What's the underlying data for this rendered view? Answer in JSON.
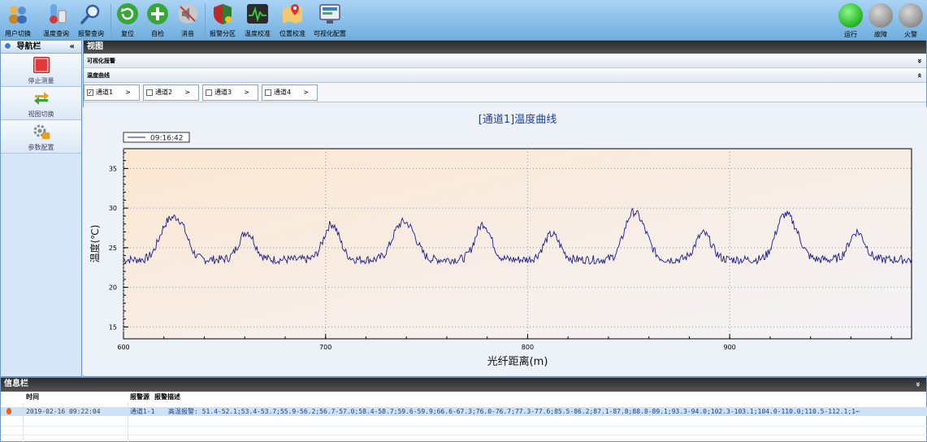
{
  "toolbar": {
    "buttons": [
      {
        "label": "用户切换",
        "icon": "users-icon"
      },
      {
        "label": "温度查询",
        "icon": "thermometer-icon"
      },
      {
        "label": "报警查询",
        "icon": "magnifier-icon"
      },
      {
        "label": "复位",
        "icon": "refresh-icon"
      },
      {
        "label": "自检",
        "icon": "plus-icon"
      },
      {
        "label": "消音",
        "icon": "mute-icon"
      },
      {
        "label": "报警分区",
        "icon": "shield-icon"
      },
      {
        "label": "温度校准",
        "icon": "waveform-icon"
      },
      {
        "label": "位置校准",
        "icon": "map-pin-icon"
      },
      {
        "label": "可视化配置",
        "icon": "monitor-icon"
      }
    ],
    "status": [
      {
        "label": "运行",
        "color": "#2fbf2f"
      },
      {
        "label": "故障",
        "color": "#9a9a9a"
      },
      {
        "label": "火警",
        "color": "#9a9a9a"
      }
    ]
  },
  "nav": {
    "title": "导航栏",
    "collapse": "«",
    "items": [
      {
        "label": "停止测量",
        "icon": "stop-icon"
      },
      {
        "label": "视图切换",
        "icon": "switch-arrows-icon"
      },
      {
        "label": "参数配置",
        "icon": "settings-icon"
      }
    ]
  },
  "view": {
    "title": "视图",
    "panel1": {
      "label": "可视化报警",
      "chevron": "»"
    },
    "panel2": {
      "label": "温度曲线",
      "chevron": "«"
    },
    "tabs": [
      {
        "label": "通道1",
        "checked": true,
        "arrow": ">"
      },
      {
        "label": "通道2",
        "checked": false,
        "arrow": ">"
      },
      {
        "label": "通道3",
        "checked": false,
        "arrow": ">"
      },
      {
        "label": "通道4",
        "checked": false,
        "arrow": ">"
      }
    ]
  },
  "chart_data": {
    "type": "line",
    "title": "[通道1]温度曲线",
    "xlabel": "光纤距离(m)",
    "ylabel": "温度(℃)",
    "xlim": [
      600,
      990
    ],
    "ylim": [
      13.5,
      37.5
    ],
    "xticks": [
      600,
      700,
      800,
      900
    ],
    "yticks": [
      15,
      20,
      25,
      30,
      35
    ],
    "grid": true,
    "legend": "top-left",
    "series": [
      {
        "name": "09:16:42",
        "color": "#1a1a8c",
        "baseline": 23.5,
        "peaks": [
          {
            "x": 621,
            "y": 27.3
          },
          {
            "x": 628,
            "y": 27.7
          },
          {
            "x": 661,
            "y": 27.0
          },
          {
            "x": 703,
            "y": 28.0
          },
          {
            "x": 736,
            "y": 26.8
          },
          {
            "x": 742,
            "y": 26.6
          },
          {
            "x": 778,
            "y": 28.0
          },
          {
            "x": 812,
            "y": 26.7
          },
          {
            "x": 851,
            "y": 28.3
          },
          {
            "x": 857,
            "y": 26.5
          },
          {
            "x": 887,
            "y": 26.8
          },
          {
            "x": 926,
            "y": 28.0
          },
          {
            "x": 932,
            "y": 26.5
          },
          {
            "x": 963,
            "y": 27.0
          }
        ]
      }
    ]
  },
  "info": {
    "title": "信息栏",
    "chevron": "»",
    "columns": {
      "time": "时间",
      "source": "报警源",
      "desc": "报警描述"
    },
    "rows": [
      {
        "time": "2019-02-16 09:22:04",
        "source": "通道1-1",
        "desc": "高温报警: 51.4-52.1;53.4-53.7;55.9-56.2;56.7-57.0;58.4-58.7;59.6-59.9;66.6-67.3;76.0-76.7;77.3-77.6;85.5-86.2;87.1-87.8;88.8-89.1;93.3-94.0;102.3-103.1;104.0-110.0;110.5-112.1;1⋯"
      }
    ]
  }
}
